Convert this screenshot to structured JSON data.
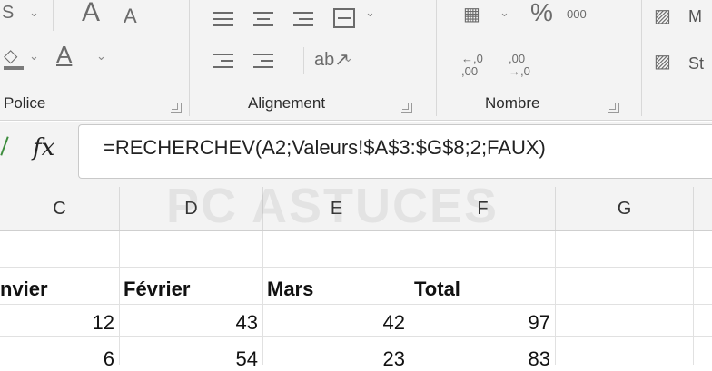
{
  "ribbon": {
    "groups": [
      {
        "label": "Police"
      },
      {
        "label": "Alignement"
      },
      {
        "label": "Nombre"
      }
    ],
    "icons": {
      "font_grow": "A",
      "font_shrink": "A",
      "font_color": "A",
      "percent": "%",
      "thousands": "000",
      "dec_inc": "←,0 ,00",
      "dec_dec": ",00 →,0",
      "partial_right_1": "M",
      "partial_right_2": "St"
    }
  },
  "formula_bar": {
    "fx_label": "fx",
    "formula": "=RECHERCHEV(A2;Valeurs!$A$3:$G$8;2;FAUX)"
  },
  "columns": [
    "C",
    "D",
    "E",
    "F",
    "G"
  ],
  "rows": [
    {
      "c": "nvier",
      "d": "Février",
      "e": "Mars",
      "f": "Total",
      "header": true
    },
    {
      "c": "12",
      "d": "43",
      "e": "42",
      "f": "97"
    },
    {
      "c": "6",
      "d": "54",
      "e": "23",
      "f": "83"
    }
  ],
  "watermark": "PC ASTUCES",
  "colors": {
    "ribbon_bg": "#f3f3f3",
    "grid_line": "#e1e1e1"
  }
}
